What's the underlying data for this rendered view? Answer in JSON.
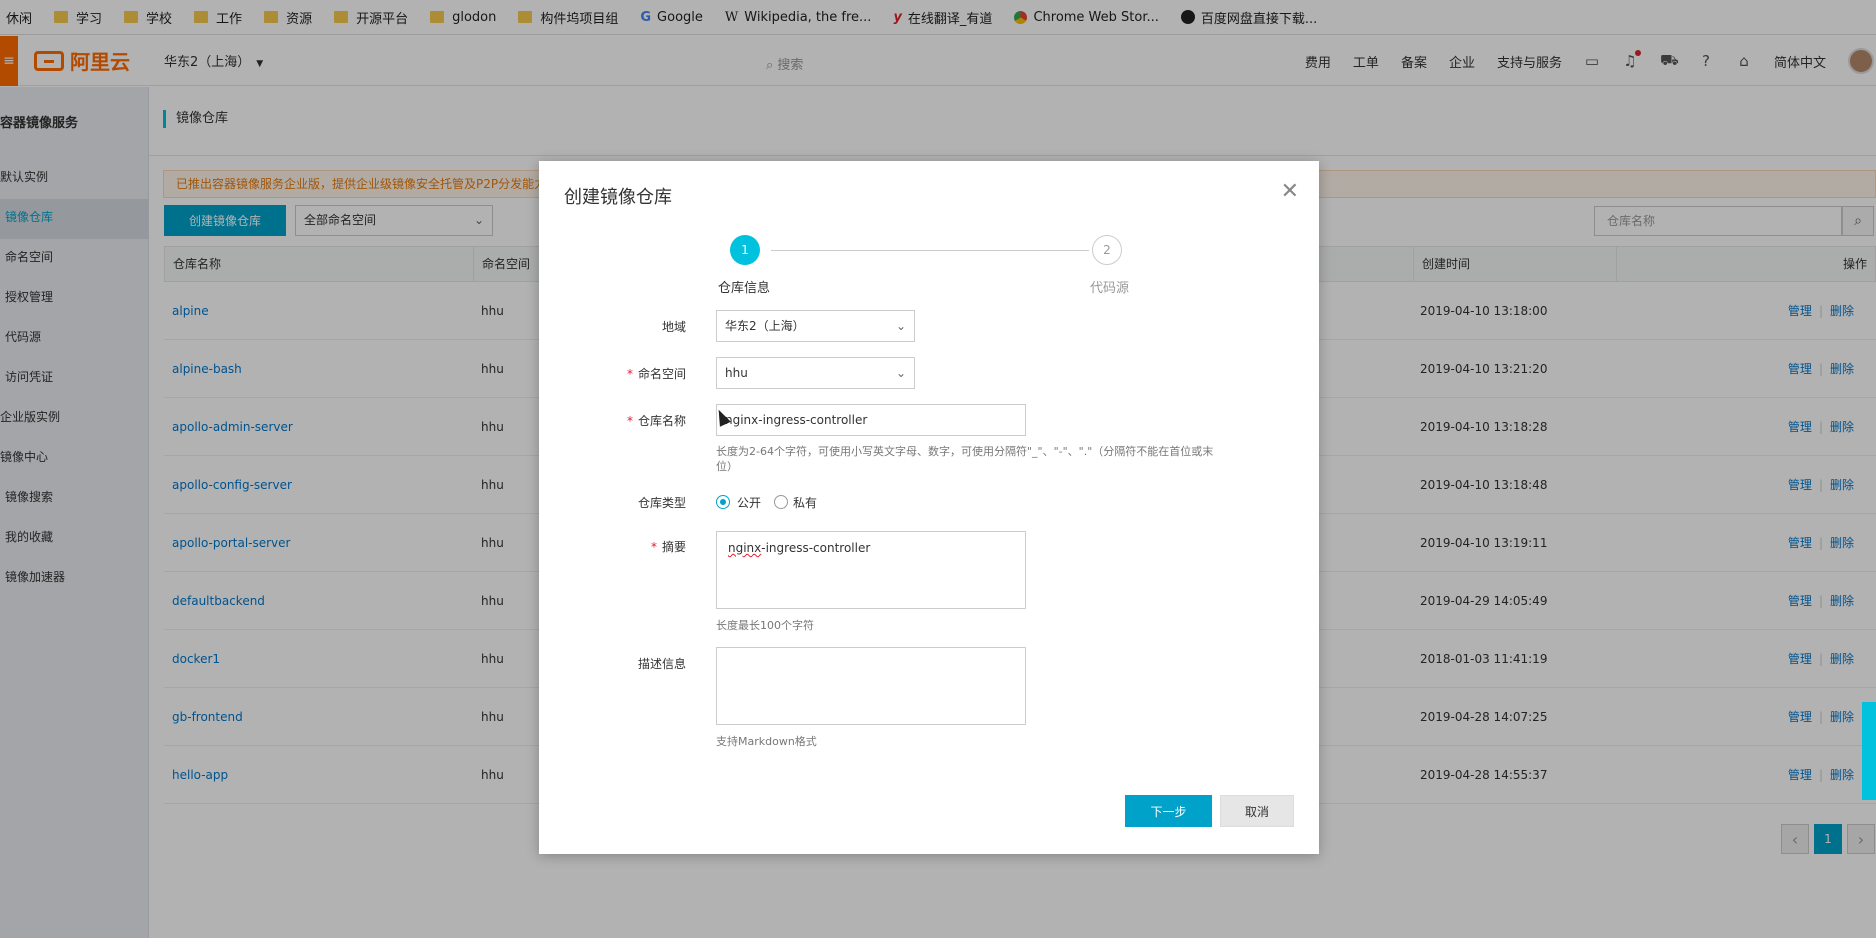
{
  "bookmarks": [
    {
      "label": "休闲",
      "icon": "none"
    },
    {
      "label": "学习",
      "icon": "folder-icon"
    },
    {
      "label": "学校",
      "icon": "folder-icon"
    },
    {
      "label": "工作",
      "icon": "folder-icon"
    },
    {
      "label": "资源",
      "icon": "folder-icon"
    },
    {
      "label": "开源平台",
      "icon": "folder-icon"
    },
    {
      "label": "glodon",
      "icon": "folder-icon"
    },
    {
      "label": "构件坞项目组",
      "icon": "folder-icon"
    },
    {
      "label": "Google",
      "icon": "google-icon"
    },
    {
      "label": "Wikipedia, the fre...",
      "icon": "wikipedia-icon"
    },
    {
      "label": "在线翻译_有道",
      "icon": "youdao-icon"
    },
    {
      "label": "Chrome Web Stor...",
      "icon": "chrome-web-store-icon"
    },
    {
      "label": "百度网盘直接下载...",
      "icon": "baidu-icon"
    }
  ],
  "topbar": {
    "logo": "阿里云",
    "region": "华东2（上海）",
    "search_placeholder": "搜索",
    "nav": [
      "费用",
      "工单",
      "备案",
      "企业",
      "支持与服务"
    ],
    "language": "简体中文"
  },
  "sidebar": {
    "title": "容器镜像服务",
    "items": [
      {
        "label": "默认实例"
      },
      {
        "label": "镜像仓库"
      },
      {
        "label": "命名空间"
      },
      {
        "label": "授权管理"
      },
      {
        "label": "代码源"
      },
      {
        "label": "访问凭证"
      },
      {
        "label": "企业版实例"
      },
      {
        "label": "镜像中心"
      },
      {
        "label": "镜像搜索"
      },
      {
        "label": "我的收藏"
      },
      {
        "label": "镜像加速器"
      }
    ]
  },
  "main": {
    "page_title": "镜像仓库",
    "notice": "已推出容器镜像服务企业版，提供企业级镜像安全托管及P2P分发能力",
    "create_button": "创建镜像仓库",
    "namespace_filter": "全部命名空间",
    "search_placeholder": "仓库名称",
    "columns": [
      "仓库名称",
      "命名空间",
      "创建时间",
      "操作"
    ],
    "rows": [
      {
        "name": "alpine",
        "namespace": "hhu",
        "created": "2019-04-10 13:18:00"
      },
      {
        "name": "alpine-bash",
        "namespace": "hhu",
        "created": "2019-04-10 13:21:20"
      },
      {
        "name": "apollo-admin-server",
        "namespace": "hhu",
        "created": "2019-04-10 13:18:28"
      },
      {
        "name": "apollo-config-server",
        "namespace": "hhu",
        "created": "2019-04-10 13:18:48"
      },
      {
        "name": "apollo-portal-server",
        "namespace": "hhu",
        "created": "2019-04-10 13:19:11"
      },
      {
        "name": "defaultbackend",
        "namespace": "hhu",
        "created": "2019-04-29 14:05:49"
      },
      {
        "name": "docker1",
        "namespace": "hhu",
        "created": "2018-01-03 11:41:19"
      },
      {
        "name": "gb-frontend",
        "namespace": "hhu",
        "created": "2019-04-28 14:07:25"
      },
      {
        "name": "hello-app",
        "namespace": "hhu",
        "created": "2019-04-28 14:55:37"
      }
    ],
    "op_manage": "管理",
    "op_delete": "删除",
    "op_sep": "|",
    "pager": {
      "prev": "‹",
      "current": "1",
      "next": "›"
    }
  },
  "modal": {
    "title": "创建镜像仓库",
    "steps": [
      {
        "num": "1",
        "label": "仓库信息"
      },
      {
        "num": "2",
        "label": "代码源"
      }
    ],
    "region_label": "地域",
    "region_value": "华东2（上海）",
    "namespace_label": "命名空间",
    "namespace_value": "hhu",
    "repo_name_label": "仓库名称",
    "repo_name_value": "nginx-ingress-controller",
    "repo_name_hint": "长度为2-64个字符，可使用小写英文字母、数字，可使用分隔符\"_\"、\"-\"、\".\"（分隔符不能在首位或末位）",
    "repo_type_label": "仓库类型",
    "repo_type_public": "公开",
    "repo_type_private": "私有",
    "summary_label": "摘要",
    "summary_value_a": "nginx",
    "summary_value_b": "-ingress-controller",
    "summary_hint": "长度最长100个字符",
    "desc_label": "描述信息",
    "desc_value": "",
    "desc_hint": "支持Markdown格式",
    "next_button": "下一步",
    "cancel_button": "取消",
    "required_mark": "*"
  },
  "colors": {
    "accent": "#00a2ca",
    "brand": "#ff6a00",
    "step_active": "#00c1de"
  }
}
